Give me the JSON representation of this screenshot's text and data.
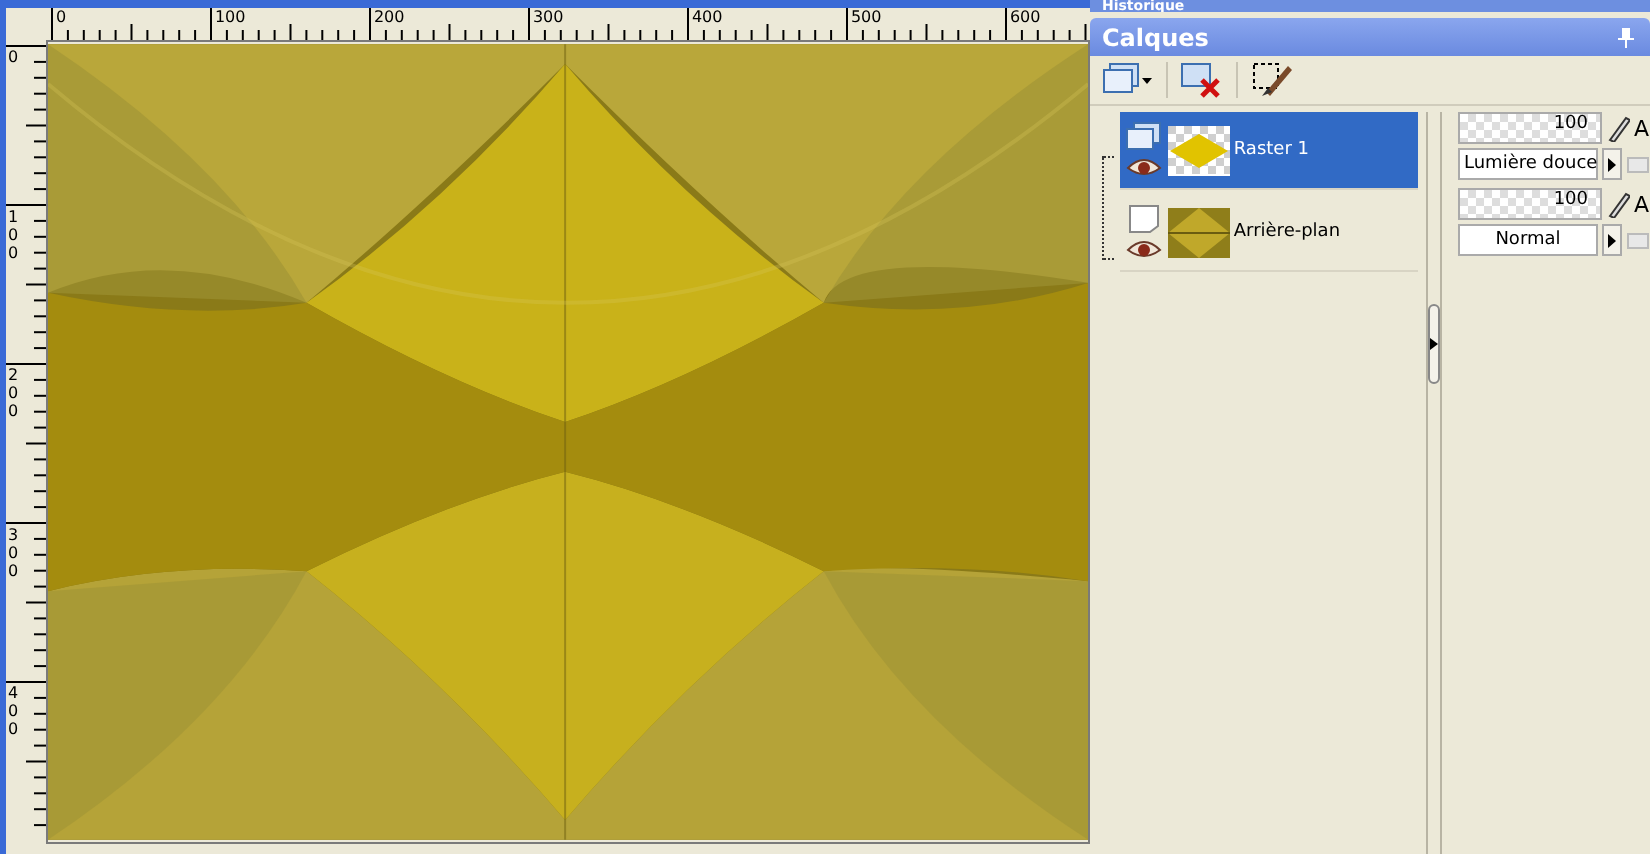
{
  "rulers": {
    "horizontal": [
      "0",
      "100",
      "200",
      "300",
      "400",
      "500",
      "600"
    ],
    "vertical": [
      "0",
      "100",
      "200",
      "300",
      "400"
    ]
  },
  "panels": {
    "history_title": "Historique",
    "layers_title": "Calques"
  },
  "layers": [
    {
      "name": "Raster 1",
      "kind": "raster",
      "selected": true,
      "visible": true,
      "opacity": "100",
      "blend_mode": "Lumière douce",
      "column_3": "A"
    },
    {
      "name": "Arrière-plan",
      "kind": "background",
      "selected": false,
      "visible": true,
      "opacity": "100",
      "blend_mode": "Normal",
      "column_3": "A"
    }
  ]
}
